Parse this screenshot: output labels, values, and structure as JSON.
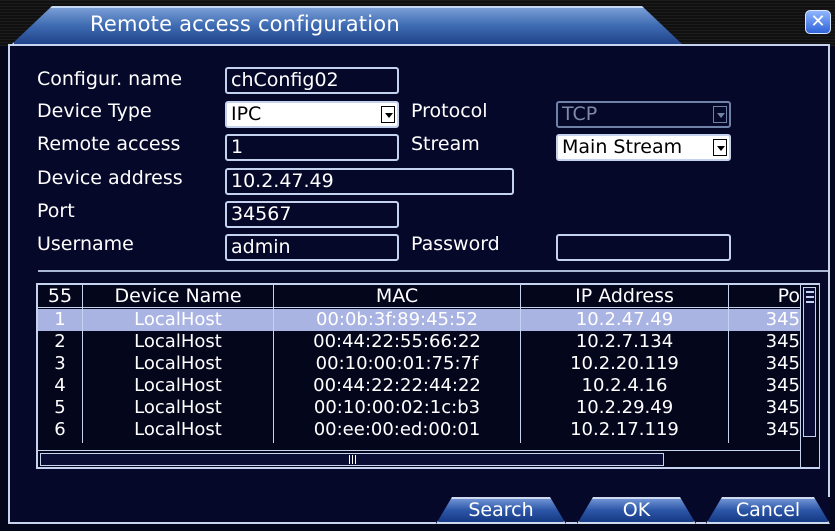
{
  "dialog": {
    "title": "Remote access configuration",
    "close_symbol": "✕"
  },
  "form": {
    "config_name_label": "Configur. name",
    "config_name_value": "chConfig02",
    "device_type_label": "Device Type",
    "device_type_value": "IPC",
    "protocol_label": "Protocol",
    "protocol_value": "TCP",
    "remote_access_label": "Remote access",
    "remote_access_value": "1",
    "stream_label": "Stream",
    "stream_value": "Main Stream",
    "device_address_label": "Device address",
    "device_address_value": "10.2.47.49",
    "port_label": "Port",
    "port_value": "34567",
    "username_label": "Username",
    "username_value": "admin",
    "password_label": "Password",
    "password_value": ""
  },
  "table": {
    "headers": [
      "55",
      "Device Name",
      "MAC",
      "IP Address",
      "Po"
    ],
    "rows": [
      [
        "1",
        "LocalHost",
        "00:0b:3f:89:45:52",
        "10.2.47.49",
        "345"
      ],
      [
        "2",
        "LocalHost",
        "00:44:22:55:66:22",
        "10.2.7.134",
        "345"
      ],
      [
        "3",
        "LocalHost",
        "00:10:00:01:75:7f",
        "10.2.20.119",
        "345"
      ],
      [
        "4",
        "LocalHost",
        "00:44:22:22:44:22",
        "10.2.4.16",
        "345"
      ],
      [
        "5",
        "LocalHost",
        "00:10:00:02:1c:b3",
        "10.2.29.49",
        "345"
      ],
      [
        "6",
        "LocalHost",
        "00:ee:00:ed:00:01",
        "10.2.17.119",
        "345"
      ]
    ],
    "selected_row": 0
  },
  "buttons": {
    "search": "Search",
    "ok": "OK",
    "cancel": "Cancel"
  },
  "colors": {
    "background": "#06082a",
    "title_tab": "#3f6cb3",
    "selected_row": "#aab4e3"
  }
}
